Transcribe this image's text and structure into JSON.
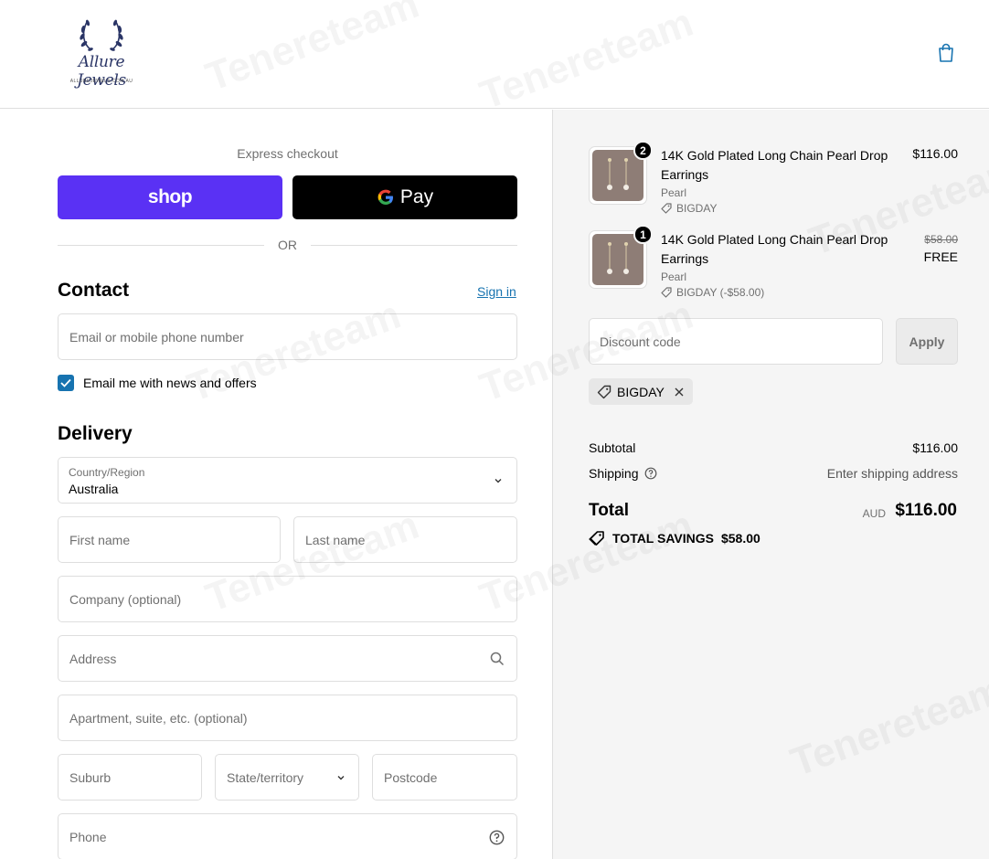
{
  "header": {
    "logo_text": "Allure Jewels",
    "logo_sub": "ALLUREJEWELS.COM.AU"
  },
  "express": {
    "label": "Express checkout",
    "shop_label": "shop",
    "gpay_label": "Pay",
    "or_label": "OR"
  },
  "contact": {
    "title": "Contact",
    "signin_label": "Sign in",
    "email_placeholder": "Email or mobile phone number",
    "newsletter_label": "Email me with news and offers",
    "newsletter_checked": true
  },
  "delivery": {
    "title": "Delivery",
    "country_label": "Country/Region",
    "country_value": "Australia",
    "first_name_placeholder": "First name",
    "last_name_placeholder": "Last name",
    "company_placeholder": "Company (optional)",
    "address_placeholder": "Address",
    "apartment_placeholder": "Apartment, suite, etc. (optional)",
    "suburb_placeholder": "Suburb",
    "state_placeholder": "State/territory",
    "postcode_placeholder": "Postcode",
    "phone_placeholder": "Phone"
  },
  "cart": {
    "items": [
      {
        "qty": "2",
        "title": "14K Gold Plated Long Chain Pearl Drop Earrings",
        "variant": "Pearl",
        "discount": "BIGDAY",
        "price": "$116.00"
      },
      {
        "qty": "1",
        "title": "14K Gold Plated Long Chain Pearl Drop Earrings",
        "variant": "Pearl",
        "discount": "BIGDAY (-$58.00)",
        "old_price": "$58.00",
        "price": "FREE"
      }
    ],
    "discount_placeholder": "Discount code",
    "apply_label": "Apply",
    "applied_code": "BIGDAY"
  },
  "summary": {
    "subtotal_label": "Subtotal",
    "subtotal_value": "$116.00",
    "shipping_label": "Shipping",
    "shipping_value": "Enter shipping address",
    "total_label": "Total",
    "currency": "AUD",
    "total_value": "$116.00",
    "savings_label": "TOTAL SAVINGS",
    "savings_value": "$58.00"
  },
  "colors": {
    "accent": "#1773b0",
    "shop_pay": "#5a31f4",
    "gpay": "#000000",
    "summary_bg": "#f5f5f5",
    "border": "#dedede"
  },
  "watermark": "Tenereteam"
}
